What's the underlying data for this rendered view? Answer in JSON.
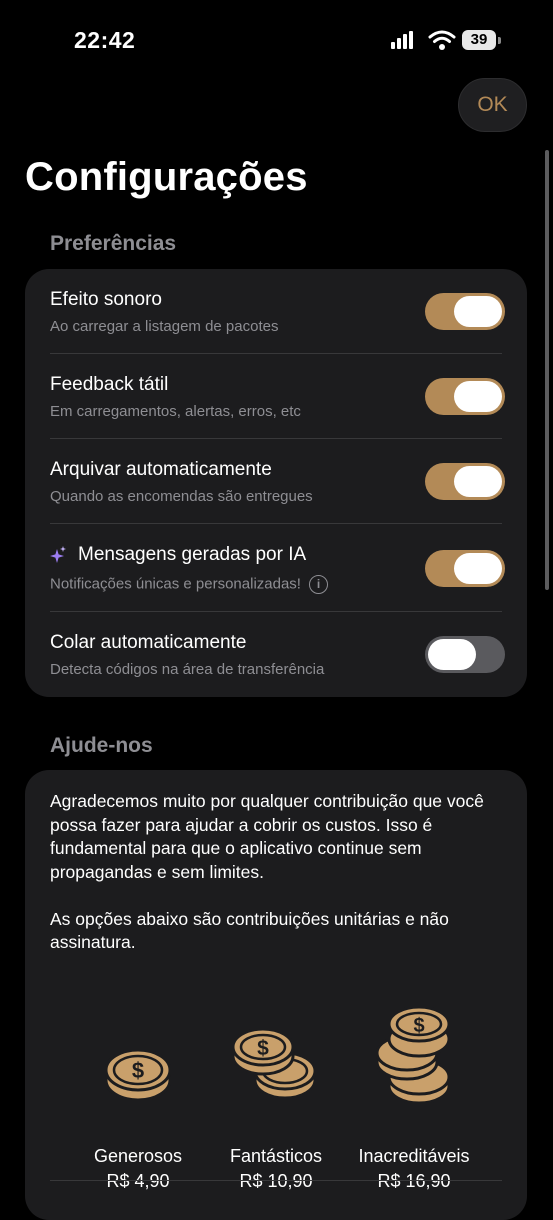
{
  "status_bar": {
    "time": "22:42",
    "battery": "39"
  },
  "header": {
    "ok_label": "OK",
    "title": "Configurações"
  },
  "preferences": {
    "section_title": "Preferências",
    "items": [
      {
        "title": "Efeito sonoro",
        "description": "Ao carregar a listagem de pacotes",
        "enabled": true
      },
      {
        "title": "Feedback tátil",
        "description": "Em carregamentos, alertas, erros, etc",
        "enabled": true
      },
      {
        "title": "Arquivar automaticamente",
        "description": "Quando as encomendas são entregues",
        "enabled": true
      },
      {
        "title": "Mensagens geradas por IA",
        "description": "Notificações únicas e personalizadas!",
        "enabled": true,
        "icon": "sparkles-icon",
        "info_icon": "info-icon"
      },
      {
        "title": "Colar automaticamente",
        "description": "Detecta códigos na área de transferência",
        "enabled": false
      }
    ]
  },
  "help": {
    "section_title": "Ajude-nos",
    "paragraph_1": "Agradecemos muito por qualquer contribuição que você possa fazer para ajudar a cobrir os custos. Isso é fundamental para que o aplicativo continue sem propagandas e sem limites.",
    "paragraph_2": "As opções abaixo são contribuições unitárias e não assinatura.",
    "tiers": [
      {
        "name": "Generosos",
        "price": "R$ 4,90",
        "icon": "single-coin-icon"
      },
      {
        "name": "Fantásticos",
        "price": "R$ 10,90",
        "icon": "two-coins-icon"
      },
      {
        "name": "Inacreditáveis",
        "price": "R$ 16,90",
        "icon": "coin-stack-icon"
      }
    ]
  },
  "colors": {
    "accent": "#b38a57",
    "background": "#000000",
    "card": "#1c1c1e",
    "secondary_text": "#8e8e93"
  }
}
